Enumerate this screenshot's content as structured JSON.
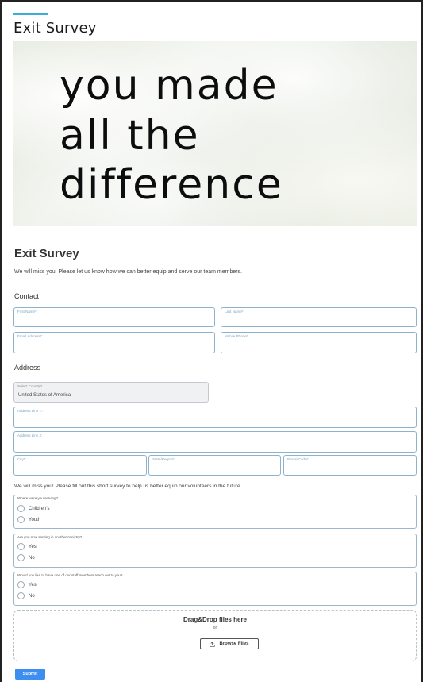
{
  "header": {
    "title": "Exit Survey",
    "accent_color": "#3ab0d8"
  },
  "banner": {
    "lines": [
      "you made",
      "all the",
      "difference"
    ]
  },
  "survey": {
    "title": "Exit Survey",
    "intro": "We will miss you! Please let us know how we can better equip and serve our team members."
  },
  "contact": {
    "section_title": "Contact",
    "first_name_label": "First Name*:",
    "last_name_label": "Last Name*:",
    "email_label": "Email Address*:",
    "mobile_label": "Mobile Phone*:"
  },
  "address": {
    "section_title": "Address",
    "country_label": "Select Country*",
    "country_value": "United States of America",
    "line1_label": "Address Line 1*:",
    "line2_label": "Address Line 2:",
    "city_label": "City*:",
    "state_label": "State/Region*:",
    "postal_label": "Postal Code*:"
  },
  "survey_note": "We will miss you! Please fill out this short survey to help us better equip our volunteers in the future.",
  "questions": [
    {
      "label": "Where were you serving?",
      "options": [
        "Children's",
        "Youth"
      ]
    },
    {
      "label": "Are you now serving in another ministry?",
      "options": [
        "Yes",
        "No"
      ]
    },
    {
      "label": "Would you like to have one of our staff members reach out to you?",
      "options": [
        "Yes",
        "No"
      ]
    }
  ],
  "upload": {
    "title": "Drag&Drop files here",
    "or": "or",
    "browse_label": "Browse Files"
  },
  "submit_label": "Submit",
  "colors": {
    "field_border": "#8fb2cc",
    "submit_bg": "#3d8ef0"
  }
}
